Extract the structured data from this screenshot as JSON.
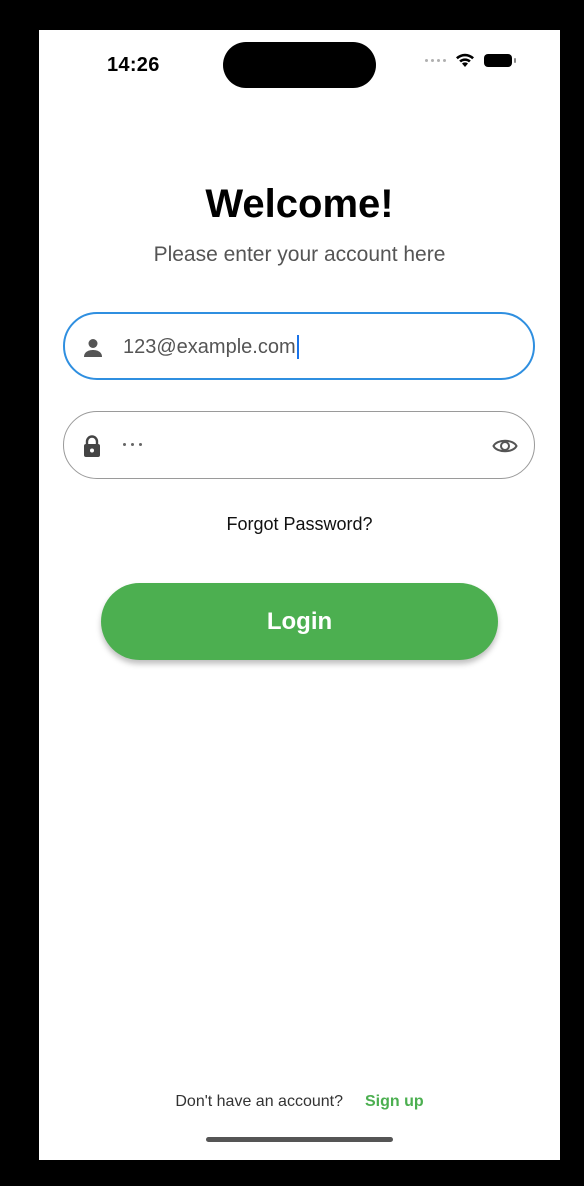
{
  "status_bar": {
    "time": "14:26"
  },
  "header": {
    "title": "Welcome!",
    "subtitle": "Please enter your account here"
  },
  "form": {
    "email_value": "123@example.com",
    "password_masked": "•••",
    "forgot_label": "Forgot Password?",
    "login_label": "Login"
  },
  "footer": {
    "prompt": "Don't have an account?",
    "signup_label": "Sign up"
  },
  "colors": {
    "accent_green": "#4caf50",
    "focus_blue": "#2f8fe0"
  },
  "icons": {
    "email_field": "person-icon",
    "password_field": "lock-icon",
    "visibility": "eye-icon"
  }
}
